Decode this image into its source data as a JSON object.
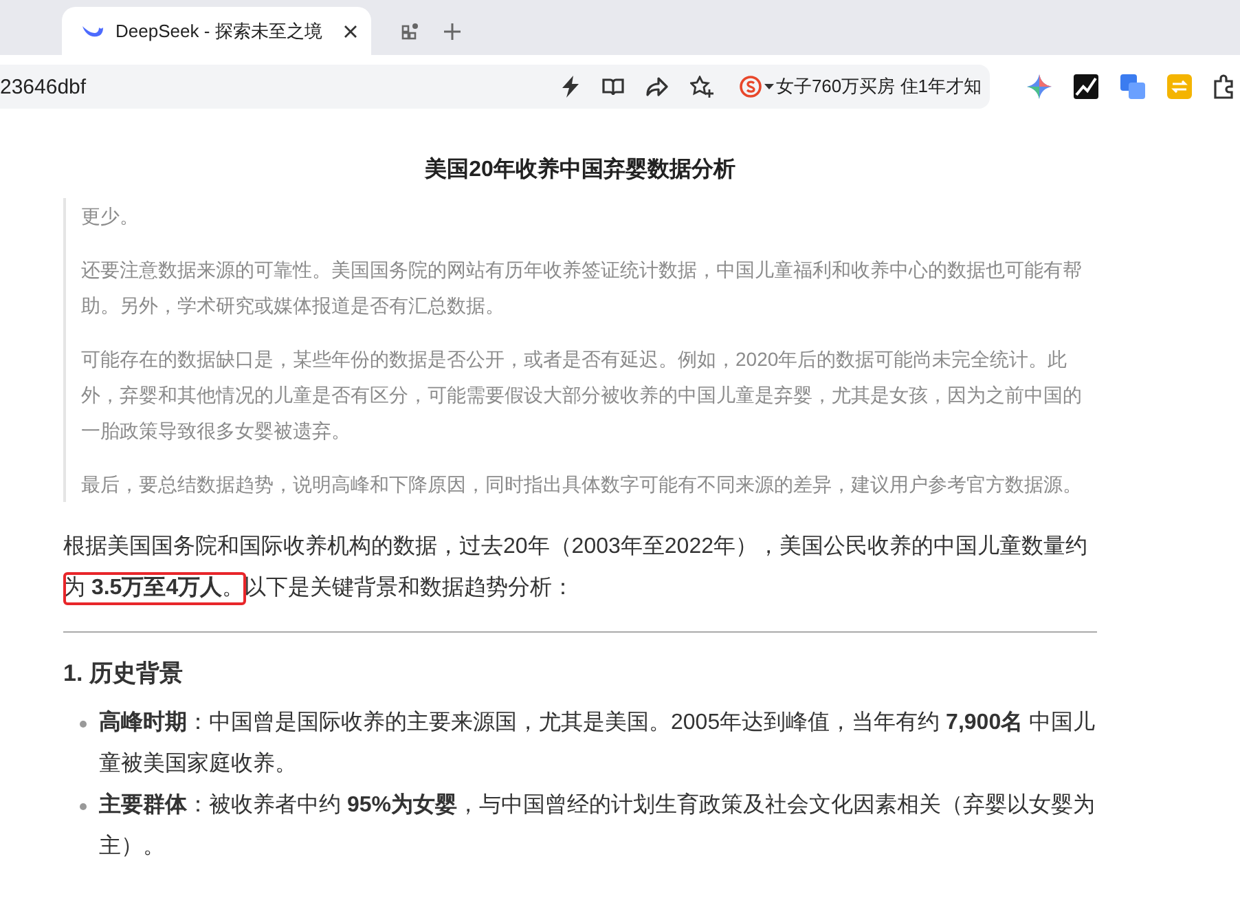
{
  "browser": {
    "tab": {
      "title": "DeepSeek - 探索未至之境",
      "selected": true
    },
    "address": "23646dbf",
    "news_ticker": "女子760万买房 住1年才知"
  },
  "article": {
    "title": "美国20年收养中国弃婴数据分析",
    "thinking": [
      "更少。",
      "还要注意数据来源的可靠性。美国国务院的网站有历年收养签证统计数据，中国儿童福利和收养中心的数据也可能有帮助。另外，学术研究或媒体报道是否有汇总数据。",
      "可能存在的数据缺口是，某些年份的数据是否公开，或者是否有延迟。例如，2020年后的数据可能尚未完全统计。此外，弃婴和其他情况的儿童是否有区分，可能需要假设大部分被收养的中国儿童是弃婴，尤其是女孩，因为之前中国的一胎政策导致很多女婴被遗弃。",
      "最后，要总结数据趋势，说明高峰和下降原因，同时指出具体数字可能有不同来源的差异，建议用户参考官方数据源。"
    ],
    "intro": "根据美国国务院和国际收养机构的数据，过去20年（2003年至2022年），美国公民收养的中国儿童数量约为 **3.5万至4万人**。以下是关键背景和数据趋势分析：",
    "section_heading": "1. 历史背景",
    "bullets": [
      "**高峰时期**：中国曾是国际收养的主要来源国，尤其是美国。2005年达到峰值，当年有约 **7,900名** 中国儿童被美国家庭收养。",
      "**主要群体**：被收养者中约 **95%为女婴**，与中国曾经的计划生育政策及社会文化因素相关（弃婴以女婴为主）。"
    ]
  }
}
